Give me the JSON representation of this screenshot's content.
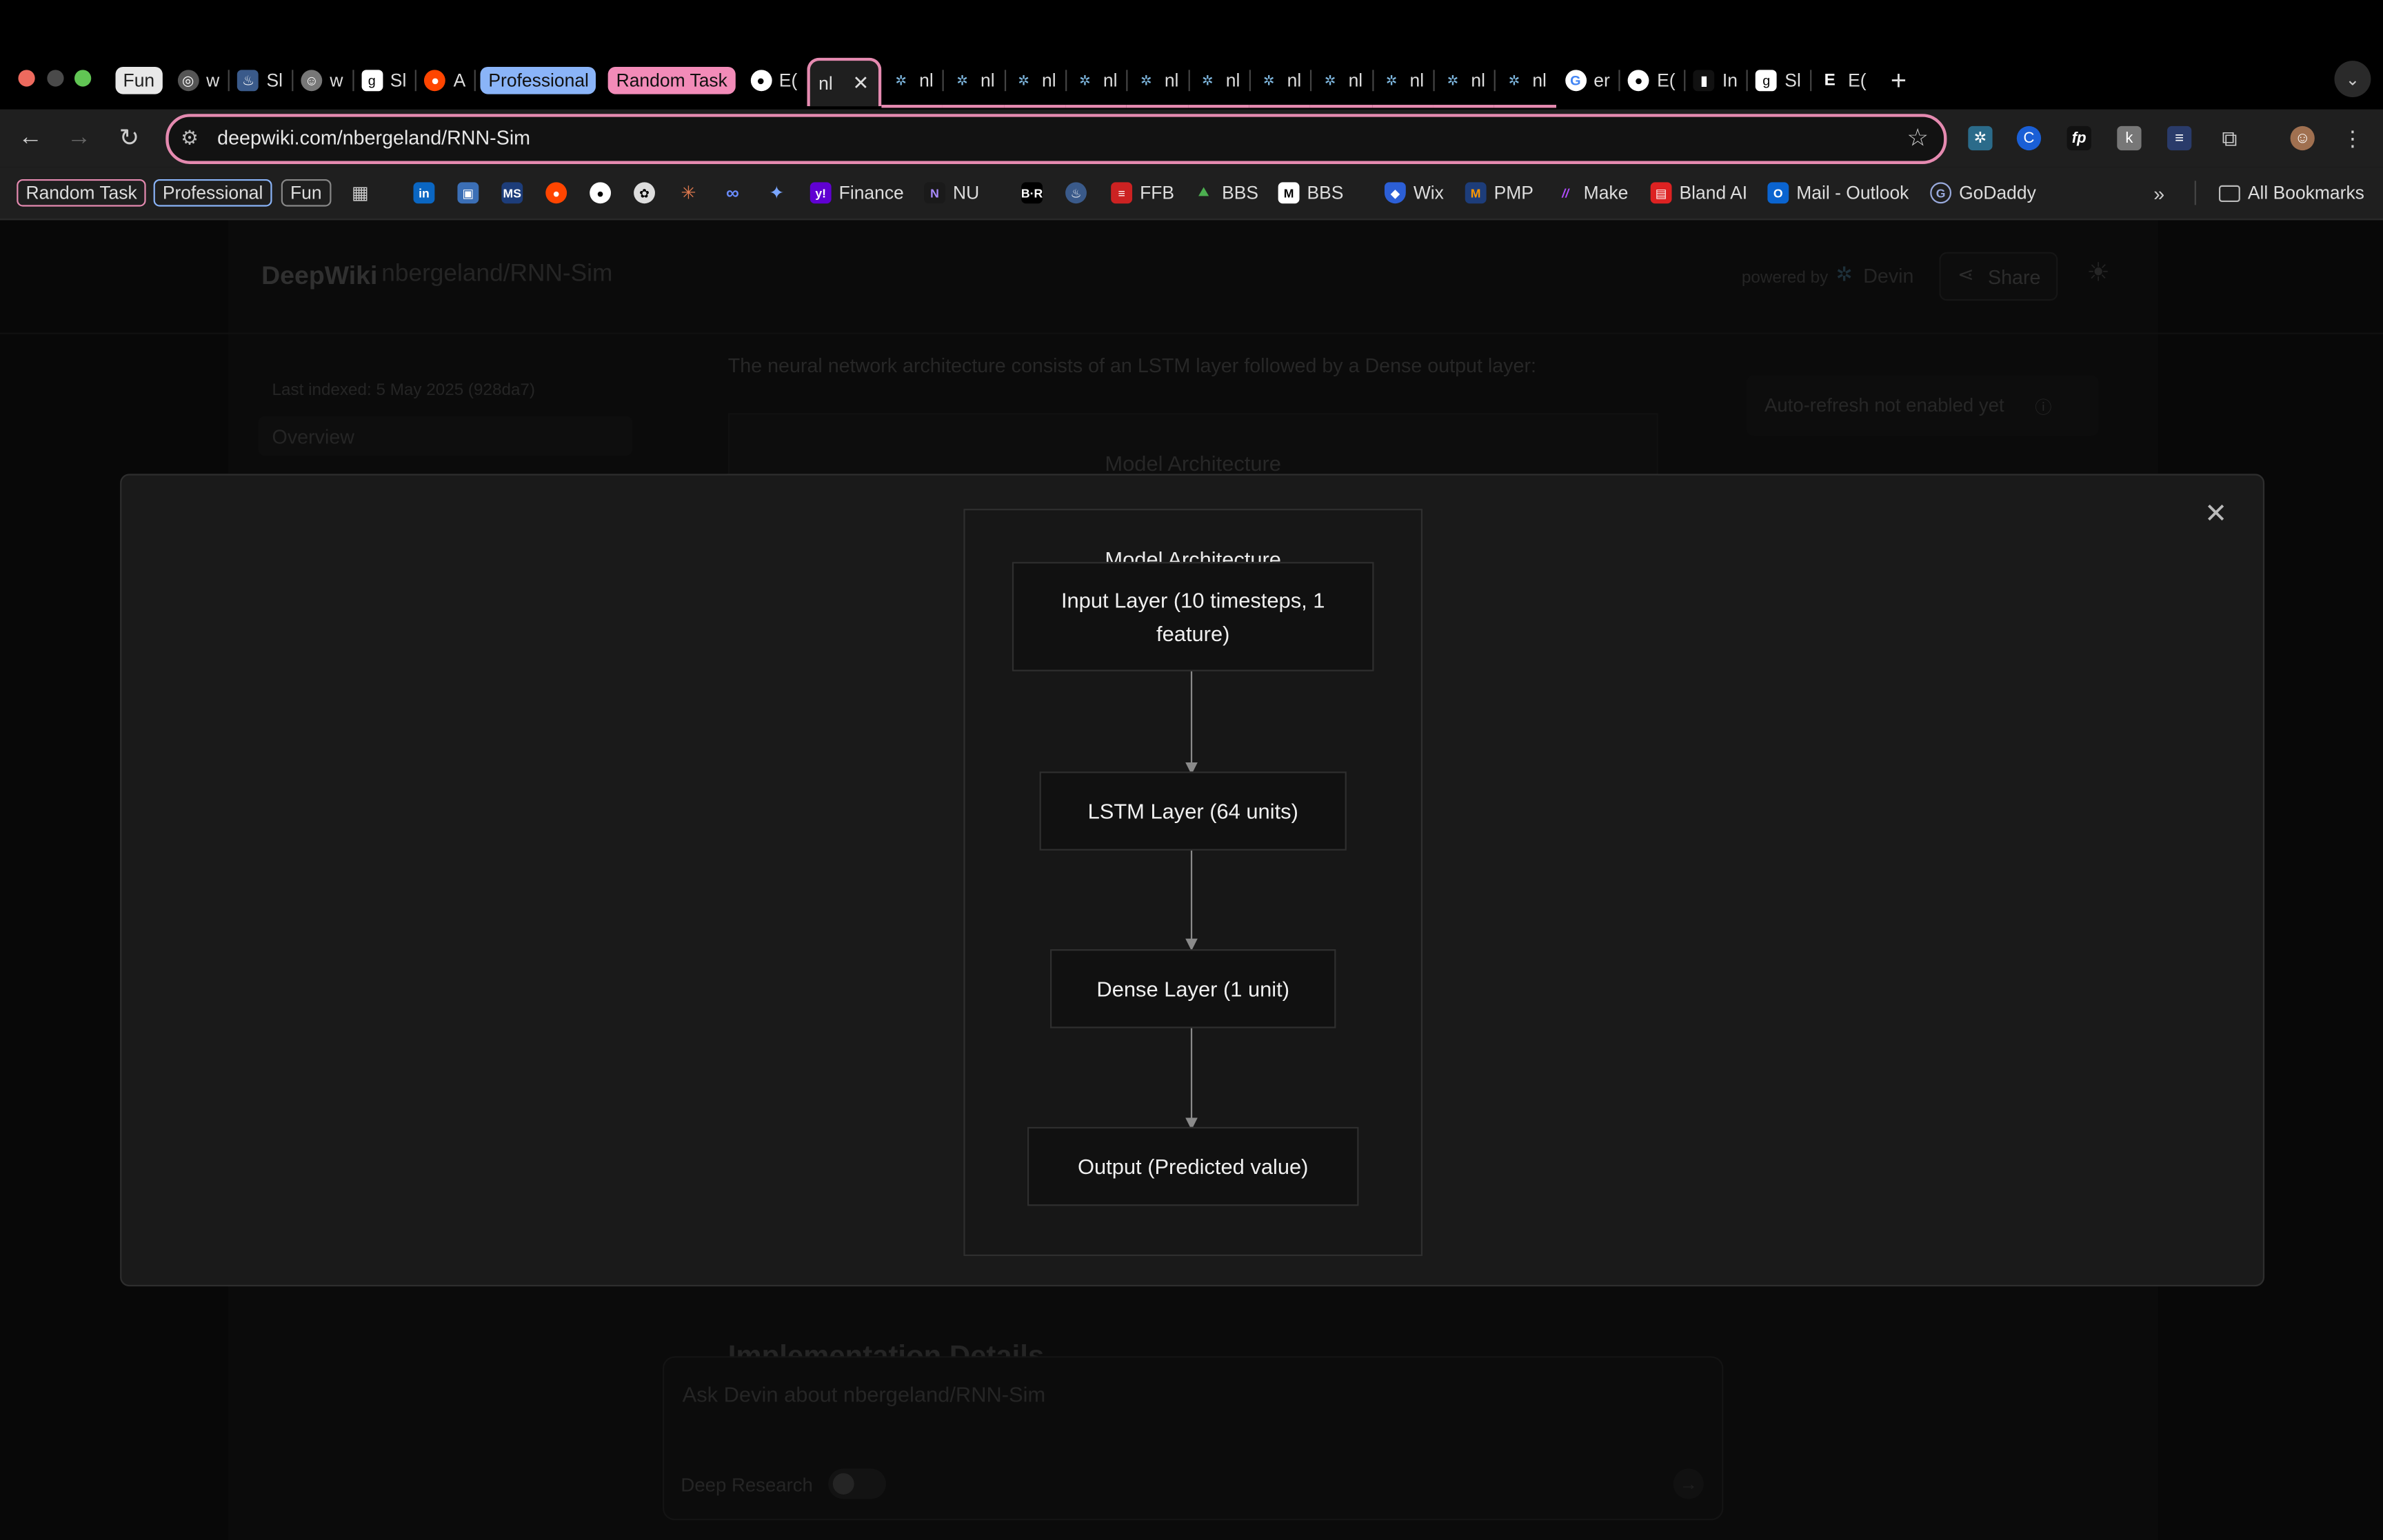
{
  "tabs": {
    "group_fun": "Fun",
    "group_professional": "Professional",
    "group_random": "Random Task",
    "items": [
      "w",
      "Sl",
      "w",
      "Sl",
      "A",
      "E(",
      "nl",
      "nl",
      "nl",
      "nl",
      "nl",
      "nl",
      "nl",
      "nl",
      "nl",
      "nl",
      "nl",
      "nl",
      "er",
      "E(",
      "In",
      "Sl",
      "E("
    ],
    "active_label": "nl"
  },
  "toolbar": {
    "url": "deepwiki.com/nbergeland/RNN-Sim"
  },
  "bookmarks": {
    "chip_random": "Random Task",
    "chip_professional": "Professional",
    "chip_fun": "Fun",
    "finance": "Finance",
    "nu": "NU",
    "ffb": "FFB",
    "bbs": "BBS",
    "bbs2": "BBS",
    "wix": "Wix",
    "pmp": "PMP",
    "make": "Make",
    "bland": "Bland AI",
    "mail": "Mail - Outlook",
    "godaddy": "GoDaddy",
    "all": "All Bookmarks"
  },
  "page": {
    "brand": "DeepWiki",
    "repo": "nbergeland/RNN-Sim",
    "powered_by": "powered by",
    "devin": "Devin",
    "share": "Share",
    "last_indexed": "Last indexed: 5 May 2025 (928da7)",
    "overview": "Overview",
    "intro_text": "The neural network architecture consists of an LSTM layer followed by a Dense output layer:",
    "bg_diagram_title": "Model Architecture",
    "auto_refresh": "Auto-refresh not enabled yet",
    "impl_heading": "Implementation Details",
    "ask_placeholder": "Ask Devin about nbergeland/RNN-Sim",
    "deep_research": "Deep Research"
  },
  "modal": {
    "title": "Model Architecture",
    "nodes": {
      "input": "Input Layer (10 timesteps, 1 feature)",
      "lstm": "LSTM Layer (64 units)",
      "dense": "Dense Layer (1 unit)",
      "output": "Output (Predicted value)"
    }
  }
}
